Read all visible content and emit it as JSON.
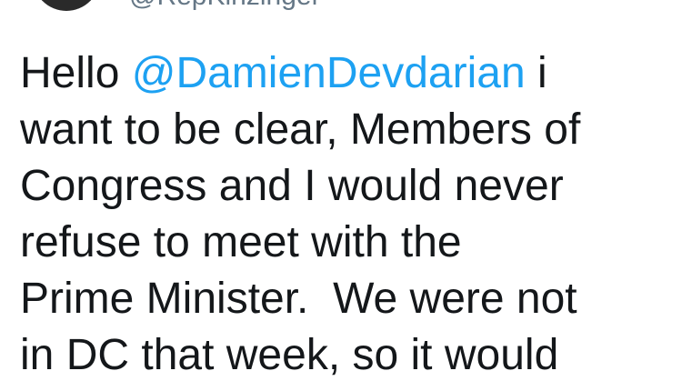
{
  "tweet": {
    "handle": "@RepKinzinger",
    "text_lines": [
      {
        "before": "Hello ",
        "mention": "@DamienDevdarian",
        "after": " i"
      },
      "want to be clear, Members of",
      "Congress and I would never",
      "refuse to meet with the",
      "Prime Minister.  We were not",
      "in DC that week, so it would"
    ]
  },
  "colors": {
    "mention": "#1da1f2",
    "text": "#14171a",
    "handle": "#657786",
    "background": "#ffffff"
  },
  "icons": {
    "avatar": "profile-avatar"
  }
}
